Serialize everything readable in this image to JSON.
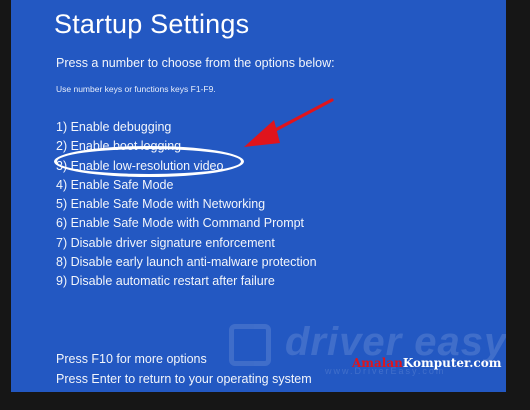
{
  "screen": {
    "title": "Startup Settings",
    "prompt": "Press a number to choose from the options below:",
    "hint": "Use number keys or functions keys F1-F9.",
    "options": [
      "1) Enable debugging",
      "2) Enable boot logging",
      "3) Enable low-resolution video",
      "4) Enable Safe Mode",
      "5) Enable Safe Mode with Networking",
      "6) Enable Safe Mode with Command Prompt",
      "7) Disable driver signature enforcement",
      "8) Disable early launch anti-malware protection",
      "9) Disable automatic restart after failure"
    ],
    "footer_more": "Press F10 for more options",
    "footer_return": "Press Enter to return to your operating system"
  },
  "annotation": {
    "highlight_color": "#ffffff",
    "arrow_color": "#e0141c"
  },
  "watermark": {
    "text": "driver easy",
    "subtext": "www.DriverEasy.com"
  },
  "brand": {
    "part1": "Amalan",
    "part2": "Komputer.com"
  },
  "colors": {
    "screen_background": "#2358c2",
    "page_background": "#161616",
    "text": "#ffffff"
  }
}
